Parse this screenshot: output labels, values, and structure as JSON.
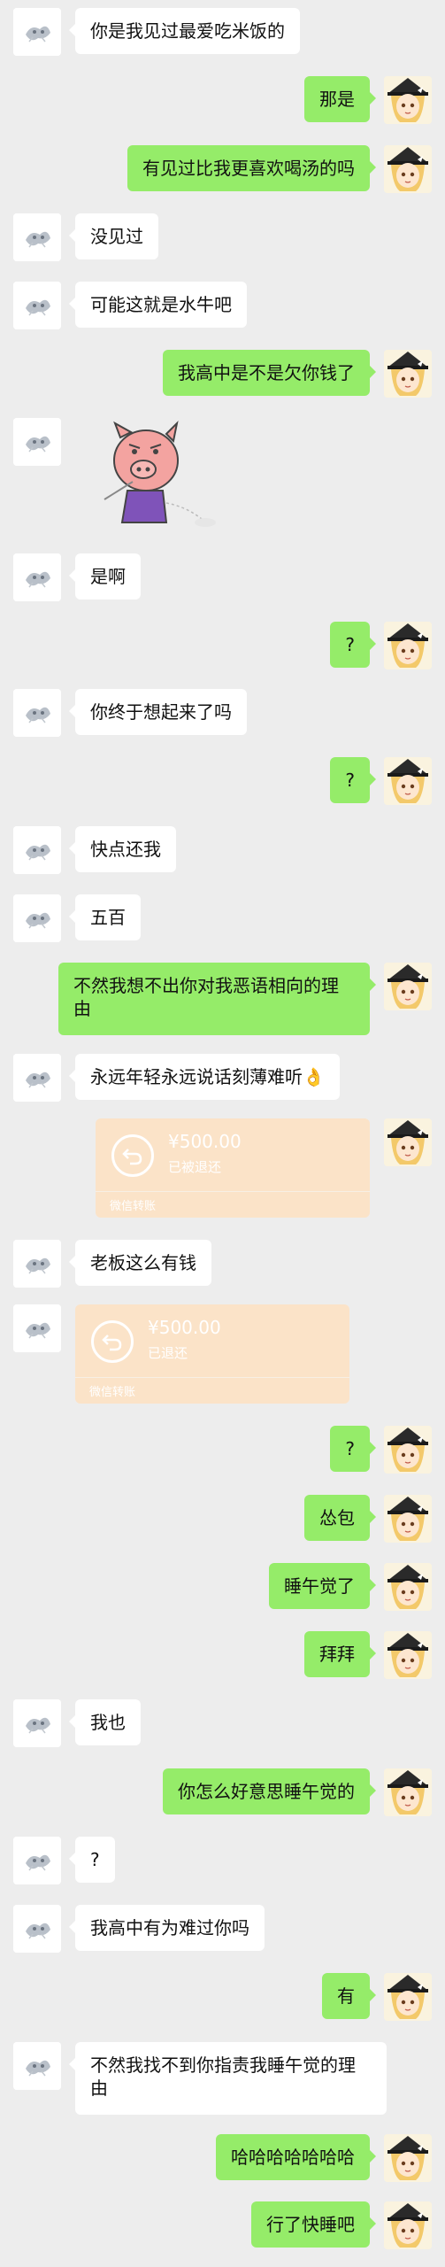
{
  "messages": [
    {
      "side": "left",
      "type": "text",
      "text": "你是我见过最爱吃米饭的"
    },
    {
      "side": "right",
      "type": "text",
      "text": "那是"
    },
    {
      "side": "right",
      "type": "text",
      "text": "有见过比我更喜欢喝汤的吗"
    },
    {
      "side": "left",
      "type": "text",
      "text": "没见过"
    },
    {
      "side": "left",
      "type": "text",
      "text": "可能这就是水牛吧"
    },
    {
      "side": "right",
      "type": "text",
      "text": "我高中是不是欠你钱了"
    },
    {
      "side": "left",
      "type": "sticker",
      "sticker": "pig-sticker"
    },
    {
      "side": "left",
      "type": "text",
      "text": "是啊"
    },
    {
      "side": "right",
      "type": "text",
      "text": "?"
    },
    {
      "side": "left",
      "type": "text",
      "text": "你终于想起来了吗"
    },
    {
      "side": "right",
      "type": "text",
      "text": "?"
    },
    {
      "side": "left",
      "type": "text",
      "text": "快点还我"
    },
    {
      "side": "left",
      "type": "text",
      "text": "五百"
    },
    {
      "side": "right",
      "type": "text",
      "text": "不然我想不出你对我恶语相向的理由"
    },
    {
      "side": "left",
      "type": "text",
      "text": "永远年轻永远说话刻薄难听👌"
    },
    {
      "side": "right",
      "type": "transfer",
      "amount": "¥500.00",
      "status": "已被退还",
      "footer": "微信转账"
    },
    {
      "side": "left",
      "type": "text",
      "text": "老板这么有钱"
    },
    {
      "side": "left",
      "type": "transfer",
      "amount": "¥500.00",
      "status": "已退还",
      "footer": "微信转账"
    },
    {
      "side": "right",
      "type": "text",
      "text": "?"
    },
    {
      "side": "right",
      "type": "text",
      "text": "怂包"
    },
    {
      "side": "right",
      "type": "text",
      "text": "睡午觉了"
    },
    {
      "side": "right",
      "type": "text",
      "text": "拜拜"
    },
    {
      "side": "left",
      "type": "text",
      "text": "我也"
    },
    {
      "side": "right",
      "type": "text",
      "text": "你怎么好意思睡午觉的"
    },
    {
      "side": "left",
      "type": "text",
      "text": "?"
    },
    {
      "side": "left",
      "type": "text",
      "text": "我高中有为难过你吗"
    },
    {
      "side": "right",
      "type": "text",
      "text": "有"
    },
    {
      "side": "left",
      "type": "text",
      "text": "不然我找不到你指责我睡午觉的理由"
    },
    {
      "side": "right",
      "type": "text",
      "text": "哈哈哈哈哈哈哈"
    },
    {
      "side": "right",
      "type": "text",
      "text": "行了快睡吧"
    }
  ]
}
